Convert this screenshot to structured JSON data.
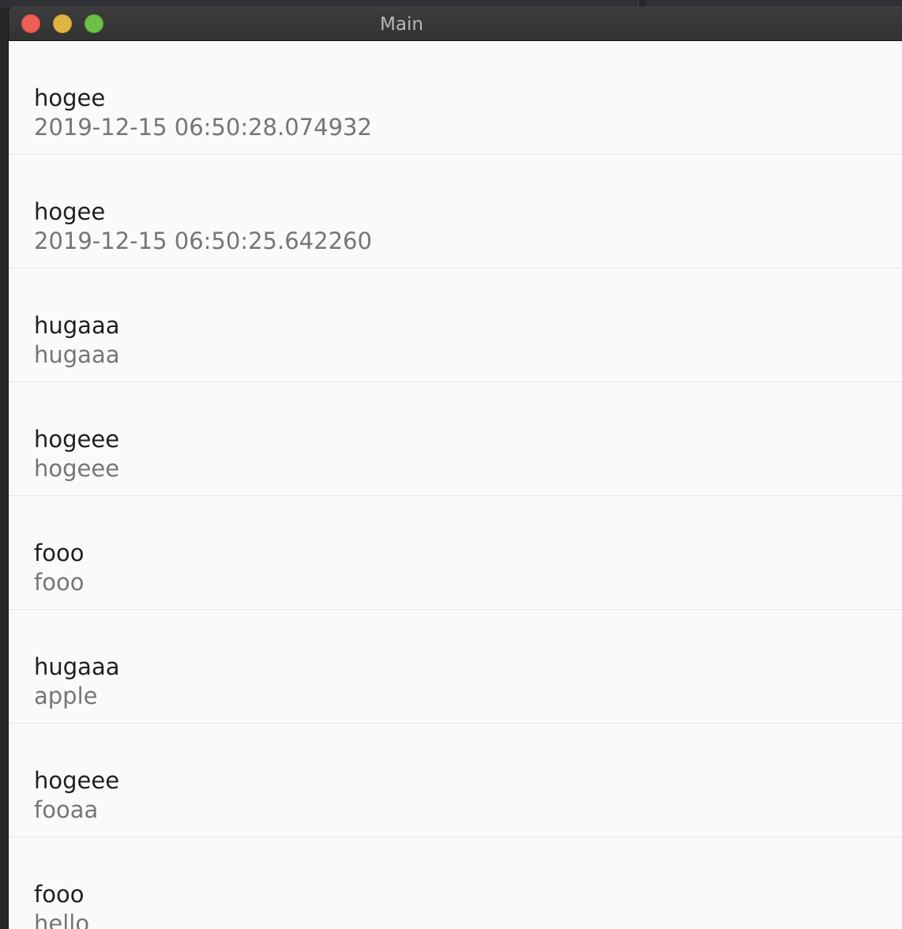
{
  "window": {
    "title": "Main"
  },
  "list": {
    "items": [
      {
        "title": "hogee",
        "subtitle": "2019-12-15 06:50:28.074932"
      },
      {
        "title": "hogee",
        "subtitle": "2019-12-15 06:50:25.642260"
      },
      {
        "title": "hugaaa",
        "subtitle": "hugaaa"
      },
      {
        "title": "hogeee",
        "subtitle": "hogeee"
      },
      {
        "title": "fooo",
        "subtitle": "fooo"
      },
      {
        "title": "hugaaa",
        "subtitle": "apple"
      },
      {
        "title": "hogeee",
        "subtitle": "fooaa"
      },
      {
        "title": "fooo",
        "subtitle": "hello"
      }
    ]
  },
  "colors": {
    "background": "#fafafa",
    "title_text": "#1f1f1f",
    "subtitle_text": "#767676",
    "divider": "#e6e6e6",
    "close": "#ee5f57",
    "minimize": "#dfb441",
    "maximize": "#6bc045"
  }
}
